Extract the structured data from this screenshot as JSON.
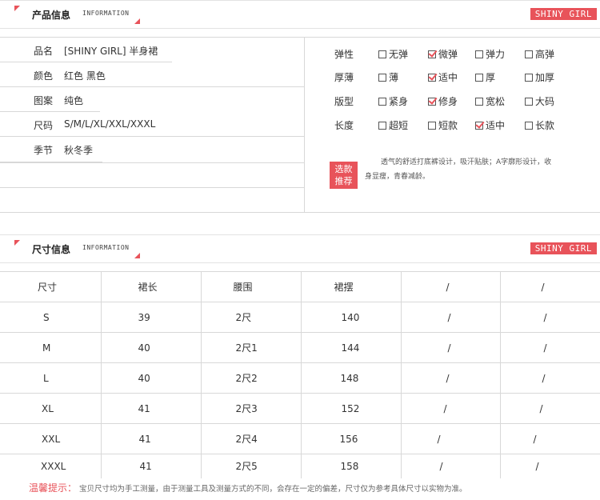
{
  "product_section": {
    "title": "产品信息",
    "subtitle": "INFORMATION",
    "brand": "SHINY GIRL"
  },
  "basic_info": [
    {
      "label": "品名",
      "value": "[SHINY GIRL] 半身裙"
    },
    {
      "label": "颜色",
      "value": "红色   黑色"
    },
    {
      "label": "图案",
      "value": "纯色"
    },
    {
      "label": "尺码",
      "value": "S/M/L/XL/XXL/XXXL"
    },
    {
      "label": "季节",
      "value": "秋冬季"
    }
  ],
  "attributes": [
    {
      "label": "弹性",
      "options": [
        {
          "text": "无弹",
          "checked": false
        },
        {
          "text": "微弹",
          "checked": true
        },
        {
          "text": "弹力",
          "checked": false
        },
        {
          "text": "高弹",
          "checked": false
        }
      ]
    },
    {
      "label": "厚薄",
      "options": [
        {
          "text": "薄",
          "checked": false
        },
        {
          "text": "适中",
          "checked": true
        },
        {
          "text": "厚",
          "checked": false
        },
        {
          "text": "加厚",
          "checked": false
        }
      ]
    },
    {
      "label": "版型",
      "options": [
        {
          "text": "紧身",
          "checked": false
        },
        {
          "text": "修身",
          "checked": true
        },
        {
          "text": "宽松",
          "checked": false
        },
        {
          "text": "大码",
          "checked": false
        }
      ]
    },
    {
      "label": "长度",
      "options": [
        {
          "text": "超短",
          "checked": false
        },
        {
          "text": "短款",
          "checked": false
        },
        {
          "text": "适中",
          "checked": true
        },
        {
          "text": "长款",
          "checked": false
        }
      ]
    }
  ],
  "recommend": {
    "badge_line1": "选款",
    "badge_line2": "推荐",
    "text": "透气的舒适打底裤设计，吸汗贴肤；A字廓形设计，收身显瘦，青春减龄。"
  },
  "size_section": {
    "title": "尺寸信息",
    "subtitle": "INFORMATION",
    "brand": "SHINY GIRL"
  },
  "size_table": {
    "headers": [
      "尺寸",
      "裙长",
      "腰围",
      "裙摆",
      "/",
      "/"
    ],
    "rows": [
      [
        "S",
        "39",
        "2尺",
        "140",
        "/",
        "/"
      ],
      [
        "M",
        "40",
        "2尺1",
        "144",
        "/",
        "/"
      ],
      [
        "L",
        "40",
        "2尺2",
        "148",
        "/",
        "/"
      ],
      [
        "XL",
        "41",
        "2尺3",
        "152",
        "/",
        "/"
      ],
      [
        "XXL",
        "41",
        "2尺4",
        "156",
        "/",
        "/"
      ],
      [
        "XXXL",
        "41",
        "2尺5",
        "158",
        "/",
        "/"
      ]
    ]
  },
  "note": {
    "label": "温馨提示：",
    "text": "宝贝尺寸均为手工测量，由于测量工具及测量方式的不同，会存在一定的偏差，尺寸仅为参考具体尺寸以实物为准。"
  },
  "colors": {
    "accent": "#e8535a",
    "border": "#d8d8d8"
  }
}
